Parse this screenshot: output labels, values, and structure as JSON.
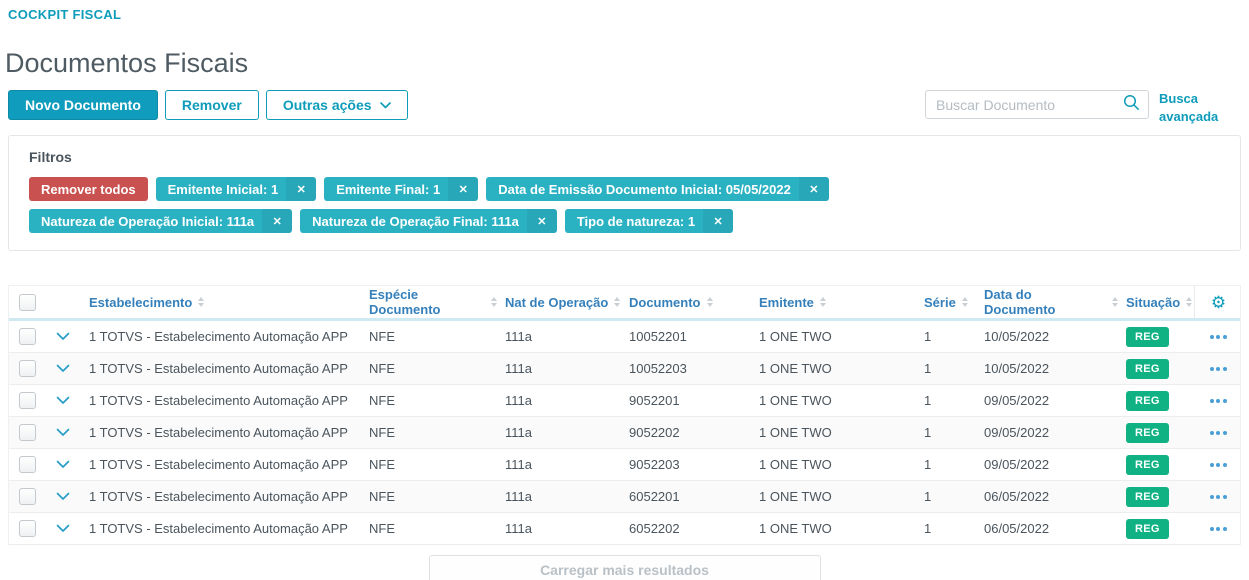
{
  "colors": {
    "accent": "#0f9cba",
    "chip_teal": "#2ab2c3",
    "danger_red": "#c9514f",
    "success_green": "#10b183",
    "header_blue": "#3580bb"
  },
  "header": {
    "breadcrumb": "COCKPIT FISCAL",
    "title": "Documentos Fiscais"
  },
  "toolbar": {
    "new_button": "Novo Documento",
    "remove_button": "Remover",
    "more_actions_button": "Outras ações",
    "search_placeholder": "Buscar Documento",
    "search_value": "",
    "advanced_search": "Busca avançada"
  },
  "filters": {
    "title": "Filtros",
    "remove_all_button": "Remover todos",
    "chips": [
      {
        "label": "Emitente Inicial: 1"
      },
      {
        "label": "Emitente Final: 1"
      },
      {
        "label": "Data de Emissão Documento Inicial: 05/05/2022"
      },
      {
        "label": "Natureza de Operação Inicial: 111a"
      },
      {
        "label": "Natureza de Operação Final: 111a"
      },
      {
        "label": "Tipo de natureza: 1"
      }
    ],
    "chip_close_icon": "✕"
  },
  "table": {
    "columns": [
      {
        "label": "Estabelecimento"
      },
      {
        "label": "Espécie Documento"
      },
      {
        "label": "Nat de Operação"
      },
      {
        "label": "Documento"
      },
      {
        "label": "Emitente"
      },
      {
        "label": "Série"
      },
      {
        "label": "Data do Documento"
      },
      {
        "label": "Situação"
      }
    ],
    "rows": [
      {
        "establishment": "1 TOTVS - Estabelecimento Automação APP",
        "species": "NFE",
        "nature": "111a",
        "document": "10052201",
        "issuer": "1 ONE TWO",
        "series": "1",
        "date": "10/05/2022",
        "status": "REG"
      },
      {
        "establishment": "1 TOTVS - Estabelecimento Automação APP",
        "species": "NFE",
        "nature": "111a",
        "document": "10052203",
        "issuer": "1 ONE TWO",
        "series": "1",
        "date": "10/05/2022",
        "status": "REG"
      },
      {
        "establishment": "1 TOTVS - Estabelecimento Automação APP",
        "species": "NFE",
        "nature": "111a",
        "document": "9052201",
        "issuer": "1 ONE TWO",
        "series": "1",
        "date": "09/05/2022",
        "status": "REG"
      },
      {
        "establishment": "1 TOTVS - Estabelecimento Automação APP",
        "species": "NFE",
        "nature": "111a",
        "document": "9052202",
        "issuer": "1 ONE TWO",
        "series": "1",
        "date": "09/05/2022",
        "status": "REG"
      },
      {
        "establishment": "1 TOTVS - Estabelecimento Automação APP",
        "species": "NFE",
        "nature": "111a",
        "document": "9052203",
        "issuer": "1 ONE TWO",
        "series": "1",
        "date": "09/05/2022",
        "status": "REG"
      },
      {
        "establishment": "1 TOTVS - Estabelecimento Automação APP",
        "species": "NFE",
        "nature": "111a",
        "document": "6052201",
        "issuer": "1 ONE TWO",
        "series": "1",
        "date": "06/05/2022",
        "status": "REG"
      },
      {
        "establishment": "1 TOTVS - Estabelecimento Automação APP",
        "species": "NFE",
        "nature": "111a",
        "document": "6052202",
        "issuer": "1 ONE TWO",
        "series": "1",
        "date": "06/05/2022",
        "status": "REG"
      }
    ]
  },
  "footer": {
    "load_more_button": "Carregar mais resultados"
  }
}
